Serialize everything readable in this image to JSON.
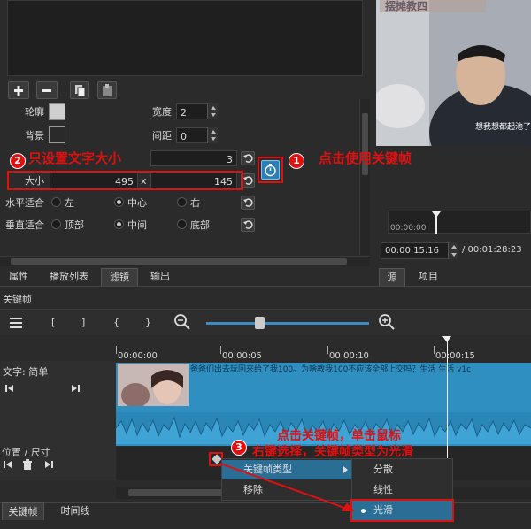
{
  "filter_panel": {
    "outline_label": "轮廓",
    "width_label": "宽度",
    "width_value": "2",
    "background_label": "背景",
    "padding_label": "间距",
    "padding_value": "0",
    "font_size_value": "3",
    "size_label": "大小",
    "size_width": "495",
    "size_x": "x",
    "size_height": "145",
    "halign_label": "水平适合",
    "halign_options": [
      "左",
      "中心",
      "右"
    ],
    "valign_label": "垂直适合",
    "valign_options": [
      "顶部",
      "中间",
      "底部"
    ]
  },
  "preview": {
    "banner_text": "摆摊教四",
    "subtitle_text": "想我想都起池了",
    "ruler_time": "00:00:00",
    "current_time": "00:00:15:16",
    "total_time": "/ 00:01:28:23"
  },
  "tabs_left": [
    "属性",
    "播放列表",
    "滤镜",
    "输出"
  ],
  "tabs_right": [
    "源",
    "项目"
  ],
  "keyframes": {
    "panel_title": "关键帧",
    "toolbar_glyphs": [
      "[",
      "]",
      "{",
      "}"
    ],
    "ruler_labels": [
      "00:00:00",
      "00:00:05",
      "00:00:10",
      "00:00:15"
    ],
    "track_text_label": "文字: 简单",
    "clip_overlay_text": "爸爸们出去玩回来给了我100。为啥教我100不应该全部上交吗？生活 生活 v1c",
    "track_position_label": "位置 / 尺寸"
  },
  "context_menu": {
    "items": [
      "关键帧类型",
      "移除"
    ],
    "submenu": [
      "分散",
      "线性",
      "光滑"
    ],
    "selected": "光滑"
  },
  "bottom_tabs": [
    "关键帧",
    "时间线"
  ],
  "annotations": {
    "a1_number": "1",
    "a1_text": "点击使用关键帧",
    "a2_number": "2",
    "a2_text": "只设置文字大小",
    "a3_number": "3",
    "a3_line1": "点击关键帧，单击鼠标",
    "a3_line2": "右键选择，关键帧类型为光滑"
  },
  "colors": {
    "annotation_red": "#e01010",
    "track_blue": "#2f8fc0",
    "menu_highlight": "#2a6e96"
  }
}
